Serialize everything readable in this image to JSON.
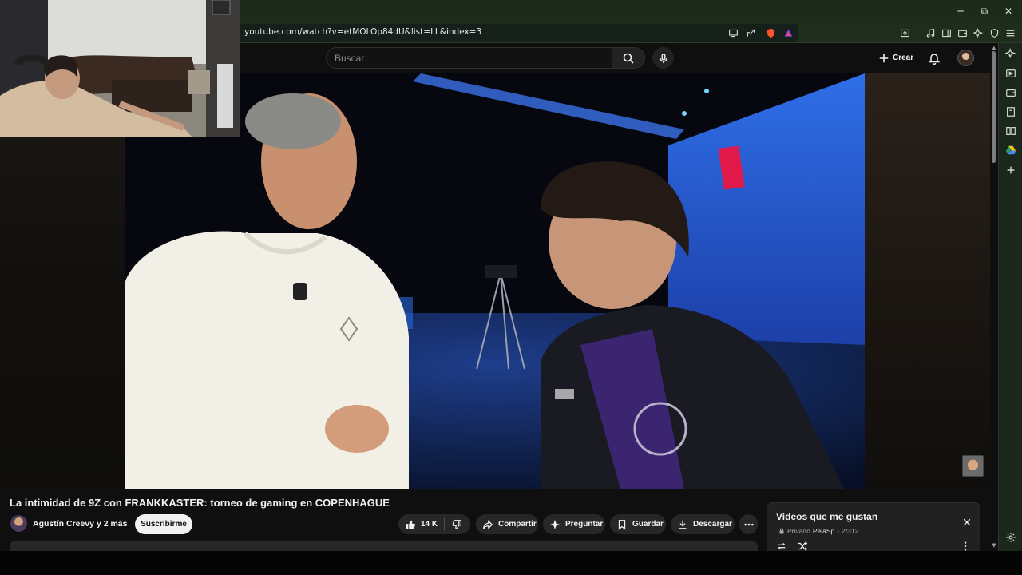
{
  "browser": {
    "url": "youtube.com/watch?v=etMOLOp84dU&list=LL&index=3",
    "window_controls": {
      "minimize": "─",
      "restore": "⧉",
      "close": "✕"
    }
  },
  "youtube": {
    "search_placeholder": "Buscar",
    "create_label": "Crear"
  },
  "video": {
    "title": "La intimidad de 9Z con FRANKKASTER: torneo de gaming en COPENHAGUE",
    "channel": "Agustín Creevy y 2 más",
    "subscribe_label": "Suscribirme",
    "like_count": "14 K",
    "actions": {
      "share": "Compartir",
      "ask": "Preguntar",
      "save": "Guardar",
      "download": "Descargar"
    }
  },
  "playlist": {
    "title": "Videos que me gustan",
    "privacy": "Privado",
    "owner": "PelaSp",
    "position": "2/312"
  },
  "colors": {
    "browser_chrome": "#1d2b1b",
    "yt_background": "#0f0f0f",
    "pill": "#272727",
    "subscribe_bg": "#f1f1f1"
  }
}
